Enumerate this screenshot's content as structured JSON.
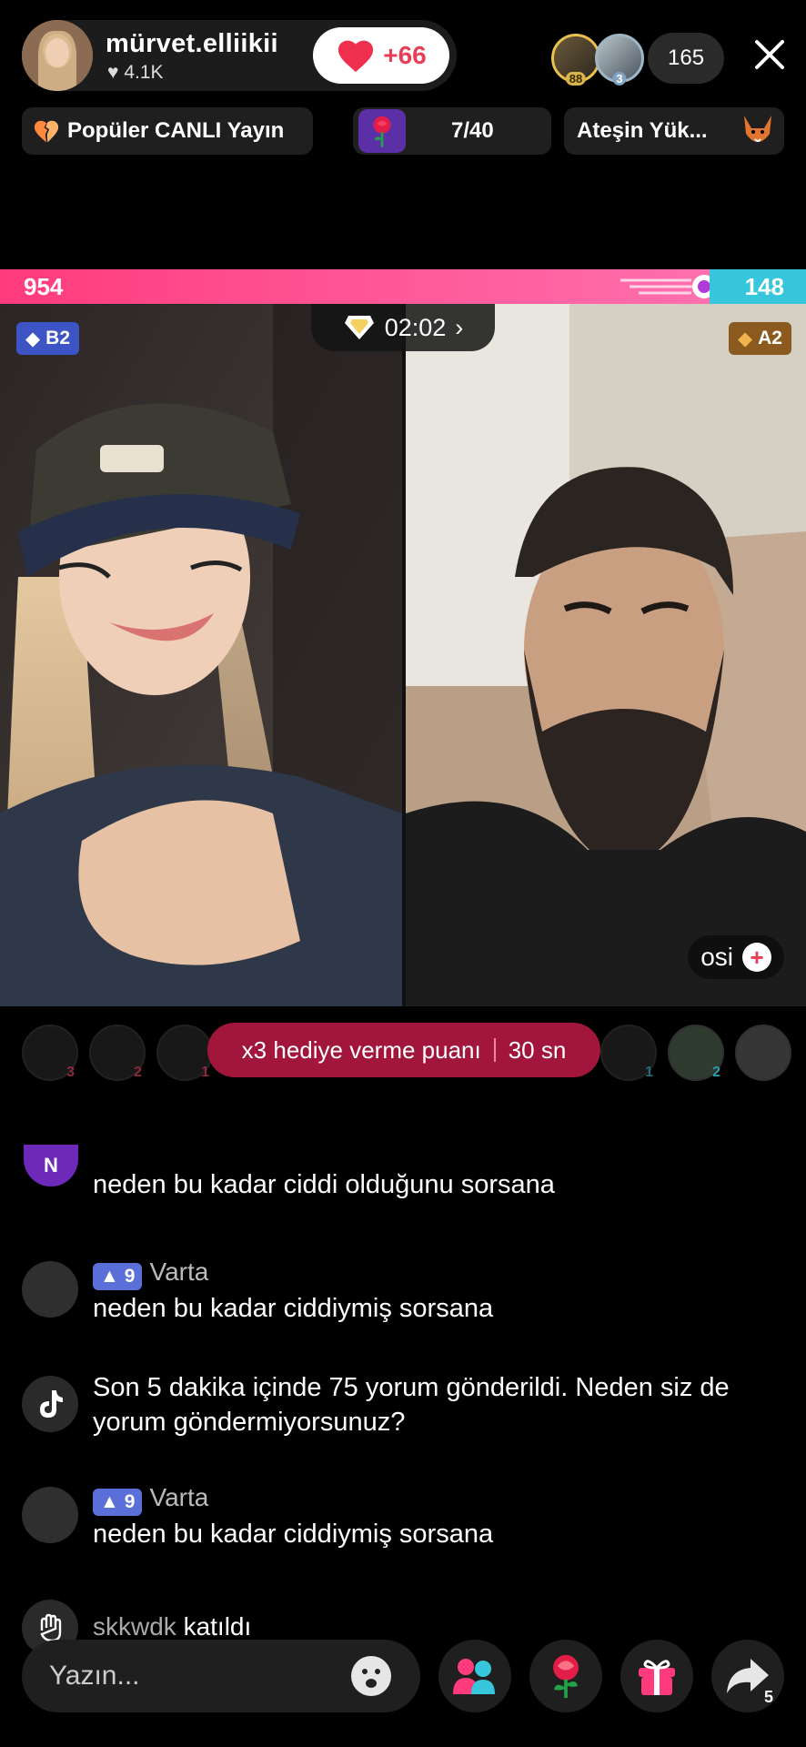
{
  "host": {
    "name": "mürvet.elliikii",
    "likes": "4.1K",
    "follow_label": "+66"
  },
  "viewers": {
    "badges": [
      "88",
      "3"
    ],
    "count": "165"
  },
  "pills": {
    "popular": "Popüler CANLI Yayın",
    "rose_progress": "7/40",
    "event": "Ateşin Yük..."
  },
  "battle": {
    "score_left": "954",
    "score_right": "148",
    "timer": "02:02",
    "rank_left": "B2",
    "rank_right": "A2",
    "opponent_name": "osi"
  },
  "multiplier": {
    "label": "x3 hediye verme puanı",
    "time": "30 sn"
  },
  "supporters_left": [
    "3",
    "2",
    "1"
  ],
  "supporters_right": [
    "1",
    "2",
    ""
  ],
  "comments": [
    {
      "type": "text",
      "avatar": "N",
      "user": "",
      "level": "",
      "text": "neden bu kadar ciddi olduğunu sorsana"
    },
    {
      "type": "text",
      "avatar": "",
      "user": "Varta",
      "level": "9",
      "text": "neden bu kadar ciddiymiş sorsana"
    },
    {
      "type": "system",
      "avatar": "",
      "user": "",
      "level": "",
      "text": "Son 5 dakika içinde 75 yorum gönderildi. Neden siz de yorum göndermiyorsunuz?"
    },
    {
      "type": "text",
      "avatar": "",
      "user": "Varta",
      "level": "9",
      "text": "neden bu kadar ciddiymiş sorsana"
    },
    {
      "type": "join",
      "avatar": "",
      "user": "skkwdk",
      "level": "",
      "text": "katıldı"
    }
  ],
  "composer": {
    "placeholder": "Yazın...",
    "share_count": "5"
  },
  "colors": {
    "accent_pink": "#ff3b7c",
    "accent_cyan": "#37c7dd",
    "multiplier_bg": "#a1163a",
    "level_badge": "#5b6fd9"
  }
}
